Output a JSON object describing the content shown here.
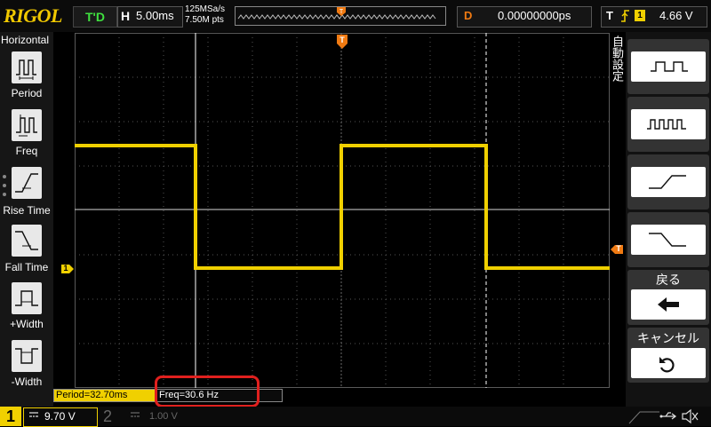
{
  "top": {
    "logo": "RIGOL",
    "run_state": "T'D",
    "timebase_label": "H",
    "timebase_value": "5.00ms",
    "sample_rate": "125MSa/s",
    "memory_depth": "7.50M pts",
    "trigger_position_marker": "T",
    "delay_label": "D",
    "delay_value": "0.00000000ps",
    "trigger_label": "T",
    "trigger_source": "1",
    "trigger_level": "4.66 V"
  },
  "left_menu": {
    "title": "Horizontal",
    "items": [
      {
        "label": "Period",
        "icon": "period-icon"
      },
      {
        "label": "Freq",
        "icon": "freq-icon"
      },
      {
        "label": "Rise Time",
        "icon": "rise-time-icon"
      },
      {
        "label": "Fall Time",
        "icon": "fall-time-icon"
      },
      {
        "label": "+Width",
        "icon": "positive-width-icon"
      },
      {
        "label": "-Width",
        "icon": "negative-width-icon"
      }
    ]
  },
  "right_menu": {
    "auto_label": "自動設定",
    "back_label": "戻る",
    "cancel_label": "キャンセル",
    "buttons": [
      {
        "icon": "single-period-icon"
      },
      {
        "icon": "multi-period-icon"
      },
      {
        "icon": "rising-edge-icon"
      },
      {
        "icon": "falling-edge-icon"
      }
    ]
  },
  "waveform": {
    "channel_marker": "1",
    "trigger_marker": "T",
    "color": "#f0d000"
  },
  "measurements": {
    "period": "Period=32.70ms",
    "freq": "Freq=30.6 Hz"
  },
  "bottom": {
    "ch1_number": "1",
    "ch1_scale": "9.70 V",
    "ch2_number": "2",
    "ch2_scale": "1.00 V"
  },
  "colors": {
    "accent_yellow": "#f0d000",
    "trigger_orange": "#f07a12",
    "highlight_red": "#e0201e",
    "run_green": "#3fe03f"
  }
}
